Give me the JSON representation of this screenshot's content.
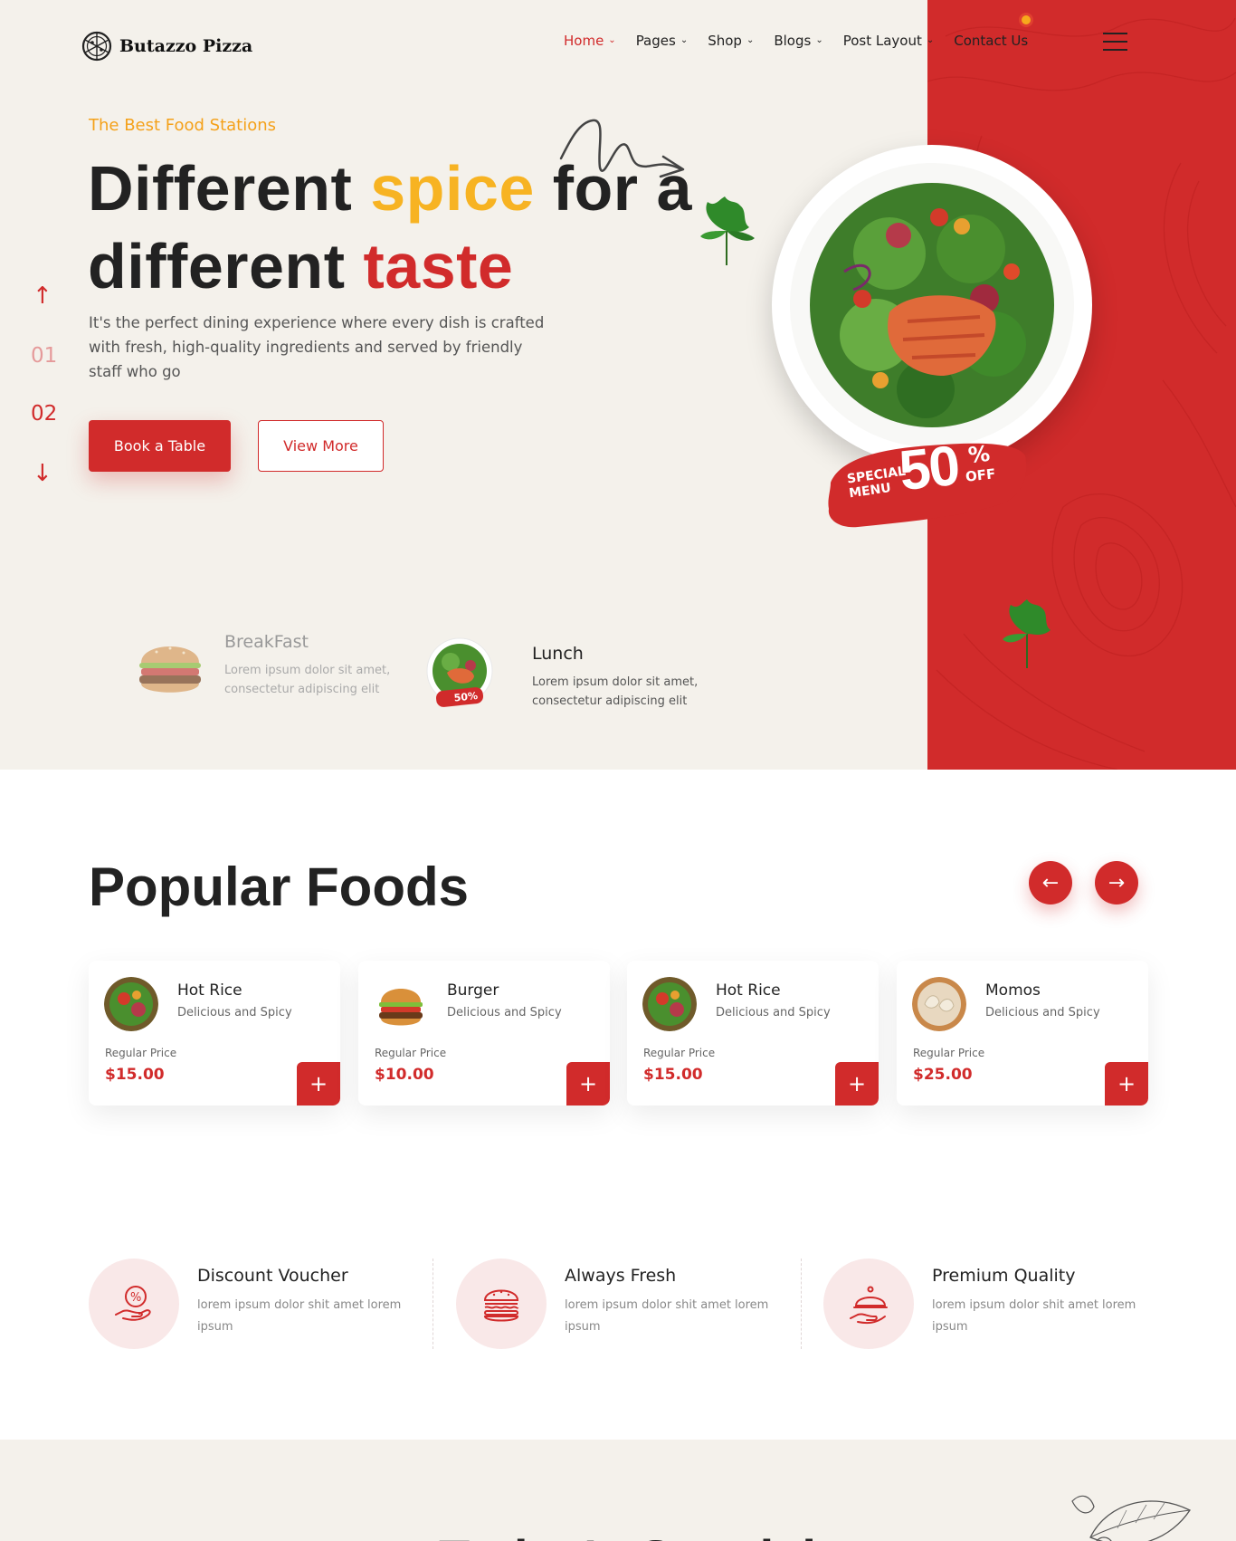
{
  "brand": {
    "name": "Butazzo Pizza",
    "icon": "pizza-icon"
  },
  "nav": [
    {
      "label": "Home",
      "active": true
    },
    {
      "label": "Pages",
      "active": false
    },
    {
      "label": "Shop",
      "active": false
    },
    {
      "label": "Blogs",
      "active": false
    },
    {
      "label": "Post Layout",
      "active": false
    },
    {
      "label": "Contact Us",
      "active": false
    }
  ],
  "hero": {
    "eyebrow": "The Best Food Stations",
    "headline": {
      "w1": "Different",
      "w2": "spice",
      "w3": "for a",
      "w4": "different",
      "w5": "taste"
    },
    "description": "It's the perfect dining experience where every dish is crafted with fresh, high-quality ingredients and served by friendly staff who go",
    "primary_button": "Book a Table",
    "secondary_button": "View More",
    "slides": [
      "01",
      "02"
    ],
    "active_slide": "02",
    "badge": {
      "special": "SPECIAL",
      "menu": "MENU",
      "amount": "50",
      "percent": "%",
      "off": "OFF"
    },
    "meals": [
      {
        "title": "BreakFast",
        "desc1": "Lorem ipsum dolor sit amet,",
        "desc2": "consectetur adipiscing elit"
      },
      {
        "title": "Lunch",
        "desc1": "Lorem ipsum dolor sit amet,",
        "desc2": "consectetur adipiscing elit"
      }
    ],
    "mini_badge": "50%"
  },
  "popular": {
    "title": "Popular Foods",
    "items": [
      {
        "name": "Hot Rice",
        "sub": "Delicious and Spicy",
        "price_label": "Regular Price",
        "price": "$15.00"
      },
      {
        "name": "Burger",
        "sub": "Delicious and Spicy",
        "price_label": "Regular Price",
        "price": "$10.00"
      },
      {
        "name": "Hot Rice",
        "sub": "Delicious and Spicy",
        "price_label": "Regular Price",
        "price": "$15.00"
      },
      {
        "name": "Momos",
        "sub": "Delicious and Spicy",
        "price_label": "Regular Price",
        "price": "$25.00"
      }
    ]
  },
  "features": [
    {
      "title": "Discount Voucher",
      "desc": "lorem ipsum dolor shit amet lorem ipsum",
      "icon": "discount-hand-icon"
    },
    {
      "title": "Always Fresh",
      "desc": "lorem ipsum dolor shit amet lorem ipsum",
      "icon": "burger-icon"
    },
    {
      "title": "Premium Quality",
      "desc": "lorem ipsum dolor shit amet lorem ipsum",
      "icon": "serving-cloche-icon"
    }
  ],
  "bottom": {
    "title": "Today's Special"
  },
  "colors": {
    "accent": "#d12b2b",
    "yellow": "#f7b322",
    "cream": "#f4f1eb"
  }
}
